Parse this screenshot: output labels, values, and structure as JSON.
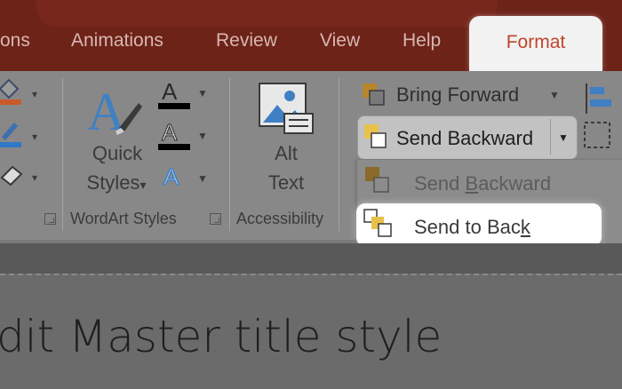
{
  "tabs": {
    "partial_left": "ons",
    "animations": "Animations",
    "review": "Review",
    "view": "View",
    "help": "Help",
    "format": "Format"
  },
  "wordart": {
    "quick_styles_line1": "Quick",
    "quick_styles_line2": "Styles",
    "quick_styles_caret": "▾",
    "group_label": "WordArt Styles",
    "text_fill_glyph": "A",
    "text_outline_glyph": "A",
    "text_effects_glyph": "A"
  },
  "accessibility": {
    "alt_text_line1": "Alt",
    "alt_text_line2": "Text",
    "group_label": "Accessibility"
  },
  "arrange": {
    "bring_forward": "Bring Forward",
    "send_backward": "Send Backward"
  },
  "dropdown": {
    "items": [
      {
        "pre": "Send ",
        "ul": "B",
        "post": "ackward",
        "state": "disabled"
      },
      {
        "pre": "Send to Bac",
        "ul": "k",
        "post": "",
        "state": "highlighted"
      }
    ]
  },
  "slide": {
    "title_partial": "dit Master title style"
  },
  "colors": {
    "tabbar": "#6e2318",
    "format_accent": "#c0442a",
    "ribbon": "#888888",
    "highlight": "#ffffff"
  }
}
